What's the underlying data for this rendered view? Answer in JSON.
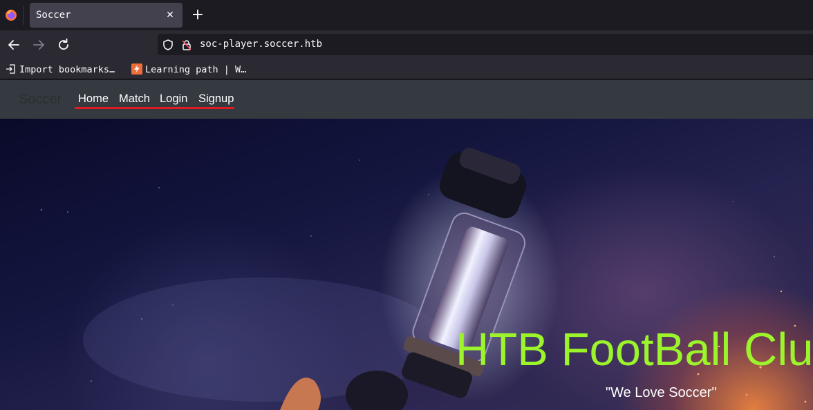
{
  "browser": {
    "tab_title": "Soccer",
    "tab_close": "✕",
    "new_tab": "+",
    "url": "soc-player.soccer.htb",
    "bookmarks": [
      {
        "label": "Import bookmarks…",
        "icon": "import-icon"
      },
      {
        "label": "Learning path | W…",
        "icon": "bookmark-favicon-icon"
      }
    ]
  },
  "site": {
    "brand": "Soccer",
    "nav": [
      "Home",
      "Match",
      "Login",
      "Signup"
    ],
    "hero_title": "HTB FootBall Club",
    "hero_subtitle": "\"We Love Soccer\""
  },
  "colors": {
    "accent_green": "#9cf52b",
    "annotation_red": "#e01b24",
    "navbar_bg": "#343a40"
  }
}
